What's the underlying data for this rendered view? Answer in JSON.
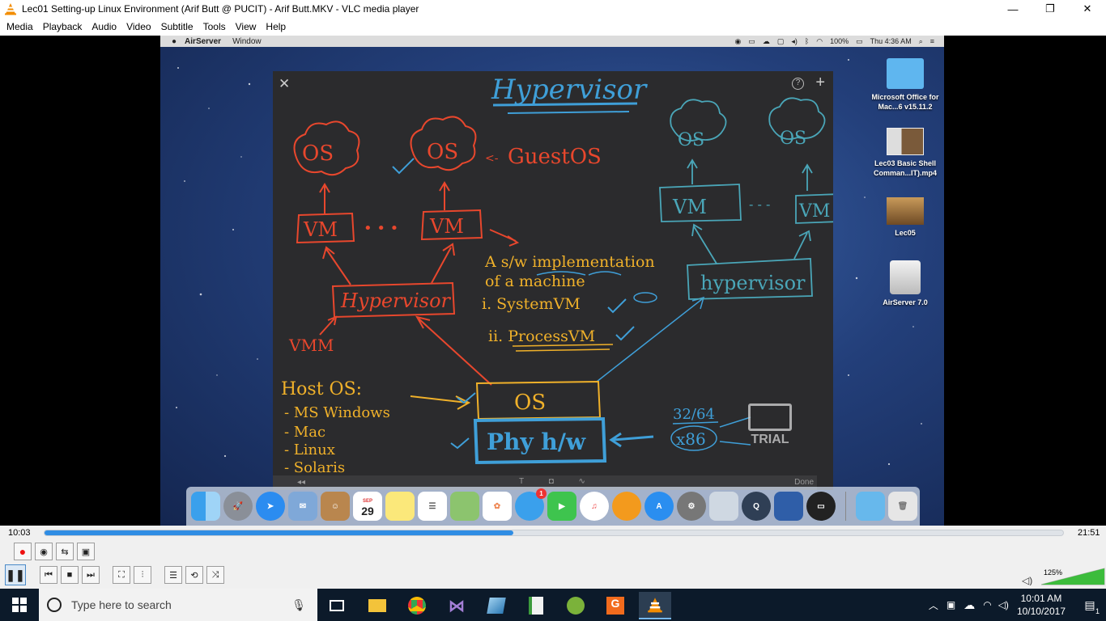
{
  "window": {
    "title": "Lec01 Setting-up Linux Environment (Arif Butt @ PUCIT) - Arif Butt.MKV - VLC media player",
    "minimize": "—",
    "restore": "❐",
    "close": "✕"
  },
  "menu": [
    "Media",
    "Playback",
    "Audio",
    "Video",
    "Subtitle",
    "Tools",
    "View",
    "Help"
  ],
  "mac": {
    "menu": [
      "AirServer",
      "Window"
    ],
    "battery": "100%",
    "clock": "Thu 4:36 AM"
  },
  "whiteboard": {
    "title": "Hypervisor",
    "guest_os": "GuestOS",
    "os": "OS",
    "vm": "VM",
    "vm_dots": "• • •",
    "hypervisor_box": "Hypervisor",
    "vmm": "VMM",
    "sw_impl_line1": "A s/w implementation",
    "sw_impl_line2": "of a machine",
    "system_vm": "i. SystemVM",
    "process_vm": "ii. ProcessVM",
    "host_os": "Host OS:",
    "host_list": [
      "- MS Windows",
      "- Mac",
      "- Linux",
      "- Solaris"
    ],
    "os_box": "OS",
    "phy_hw": "Phy h/w",
    "arch_top": "32/64",
    "arch_bottom": "x86",
    "right_hypervisor": "hypervisor",
    "right_dots": "- - -",
    "done": "Done",
    "back": "◂◂",
    "tools": "T ◘ ∿"
  },
  "trial_label": "TRIAL",
  "desktop_icons": [
    {
      "label": "Microsoft Office for Mac...6 v15.11.2"
    },
    {
      "label": "Lec03 Basic Shell Comman...IT).mp4"
    },
    {
      "label": "Lec05"
    },
    {
      "label": "AirServer 7.0"
    }
  ],
  "dock_calendar": {
    "month": "SEP",
    "day": "29"
  },
  "dock_badge": "1",
  "player": {
    "elapsed": "10:03",
    "duration": "21:51",
    "progress": 0.46,
    "volume": "125%"
  },
  "taskbar": {
    "search_placeholder": "Type here to search",
    "time": "10:01 AM",
    "date": "10/10/2017",
    "notification_count": "1"
  },
  "colors": {
    "vlc_orange": "#f28c00",
    "marker_red": "#e8472d",
    "marker_yellow": "#f0b12a",
    "marker_blue": "#3f9fd8",
    "marker_teal": "#4aa6b8"
  }
}
